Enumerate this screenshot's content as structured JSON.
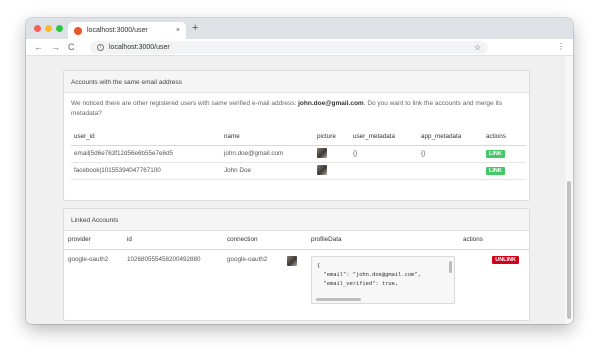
{
  "browser": {
    "tab_title": "localhost:3000/user",
    "tab_close": "×",
    "new_tab": "+",
    "url": "localhost:3000/user",
    "back": "←",
    "forward": "→",
    "reload": "C",
    "info": "i",
    "star": "☆",
    "menu": "⋮"
  },
  "same_email": {
    "heading": "Accounts with the same email address",
    "notice_before": "We noticed there are other registered users with same verified e-mail address: ",
    "notice_email": "john.doe@gmail.com",
    "notice_after": ". Do you want to link the accounts and merge its metadata?",
    "columns": [
      "user_id",
      "name",
      "picture",
      "user_metadata",
      "app_metadata",
      "actions"
    ],
    "rows": [
      {
        "user_id": "email|5d6e763f12d56e6b55e7e6d5",
        "name": "john.doe@gmail.com",
        "user_metadata": "{}",
        "app_metadata": "{}",
        "action": "LINK"
      },
      {
        "user_id": "facebook|10155394047767100",
        "name": "John Doe",
        "user_metadata": "",
        "app_metadata": "",
        "action": "LINK"
      }
    ]
  },
  "linked": {
    "heading": "Linked Accounts",
    "columns": [
      "provider",
      "id",
      "connection",
      "profileData",
      "actions"
    ],
    "rows": [
      {
        "provider": "google-oauth2",
        "id": "102680555458200492880",
        "connection": "google-oauth2",
        "profile_lines": [
          "{",
          "  \"email\": \"john.doe@gmail.com\",",
          "  \"email_verified\": true,"
        ],
        "action": "UNLINK"
      }
    ]
  },
  "colors": {
    "link": "#44c767",
    "unlink": "#d0021b"
  }
}
